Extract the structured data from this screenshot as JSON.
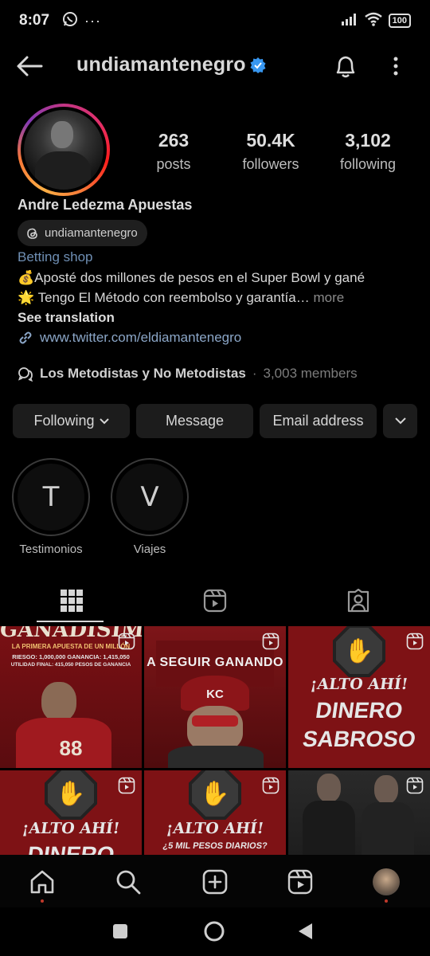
{
  "status_bar": {
    "time": "8:07",
    "battery": "100"
  },
  "header": {
    "username": "undiamantenegro"
  },
  "stats": [
    {
      "value": "263",
      "label": "posts"
    },
    {
      "value": "50.4K",
      "label": "followers"
    },
    {
      "value": "3,102",
      "label": "following"
    }
  ],
  "profile": {
    "display_name": "Andre Ledezma Apuestas",
    "threads_handle": "undiamantenegro",
    "category": "Betting shop",
    "bio_line1": "💰Aposté dos millones de pesos en el Super Bowl y gané",
    "bio_line2": "🌟 Tengo El Método con reembolso y garantía…",
    "more_label": "more",
    "see_translation": "See translation",
    "link": "www.twitter.com/eldiamantenegro",
    "channel_name": "Los Metodistas y No Metodistas",
    "channel_sep": "·",
    "channel_members": "3,003 members"
  },
  "actions": {
    "following": "Following",
    "message": "Message",
    "email": "Email address"
  },
  "highlights": [
    {
      "letter": "T",
      "label": "Testimonios"
    },
    {
      "letter": "V",
      "label": "Viajes"
    }
  ],
  "grid": {
    "tile1": {
      "title": "GANADISIMO",
      "subtitle": "LA PRIMERA APUESTA DE UN MILLÓN",
      "line1": "RIESGO: 1,000,000   GANANCIA: 1,415,050",
      "line2": "UTILIDAD FINAL: 415,050 PESOS DE GANANCIA",
      "jersey": "88"
    },
    "tile2": {
      "title": "A SEGUIR GANANDO",
      "cap": "KC"
    },
    "tile3": {
      "line1": "¡ALTO AHÍ!",
      "line2": "DINERO",
      "line3": "SABROSO"
    },
    "tile4": {
      "line1": "¡ALTO AHÍ!",
      "line2": "DINERO"
    },
    "tile5": {
      "line1": "¡ALTO AHÍ!",
      "line2": "¿5 MIL PESOS DIARIOS?"
    }
  },
  "icons": {
    "back": "back-arrow-icon",
    "verified": "verified-badge-icon",
    "bell": "bell-icon",
    "more": "more-vertical-icon"
  },
  "colors": {
    "background": "#000000",
    "link": "#8ba6c7",
    "category": "#6f8fb4",
    "verified": "#3897f0",
    "poster_red": "#b3161b"
  }
}
